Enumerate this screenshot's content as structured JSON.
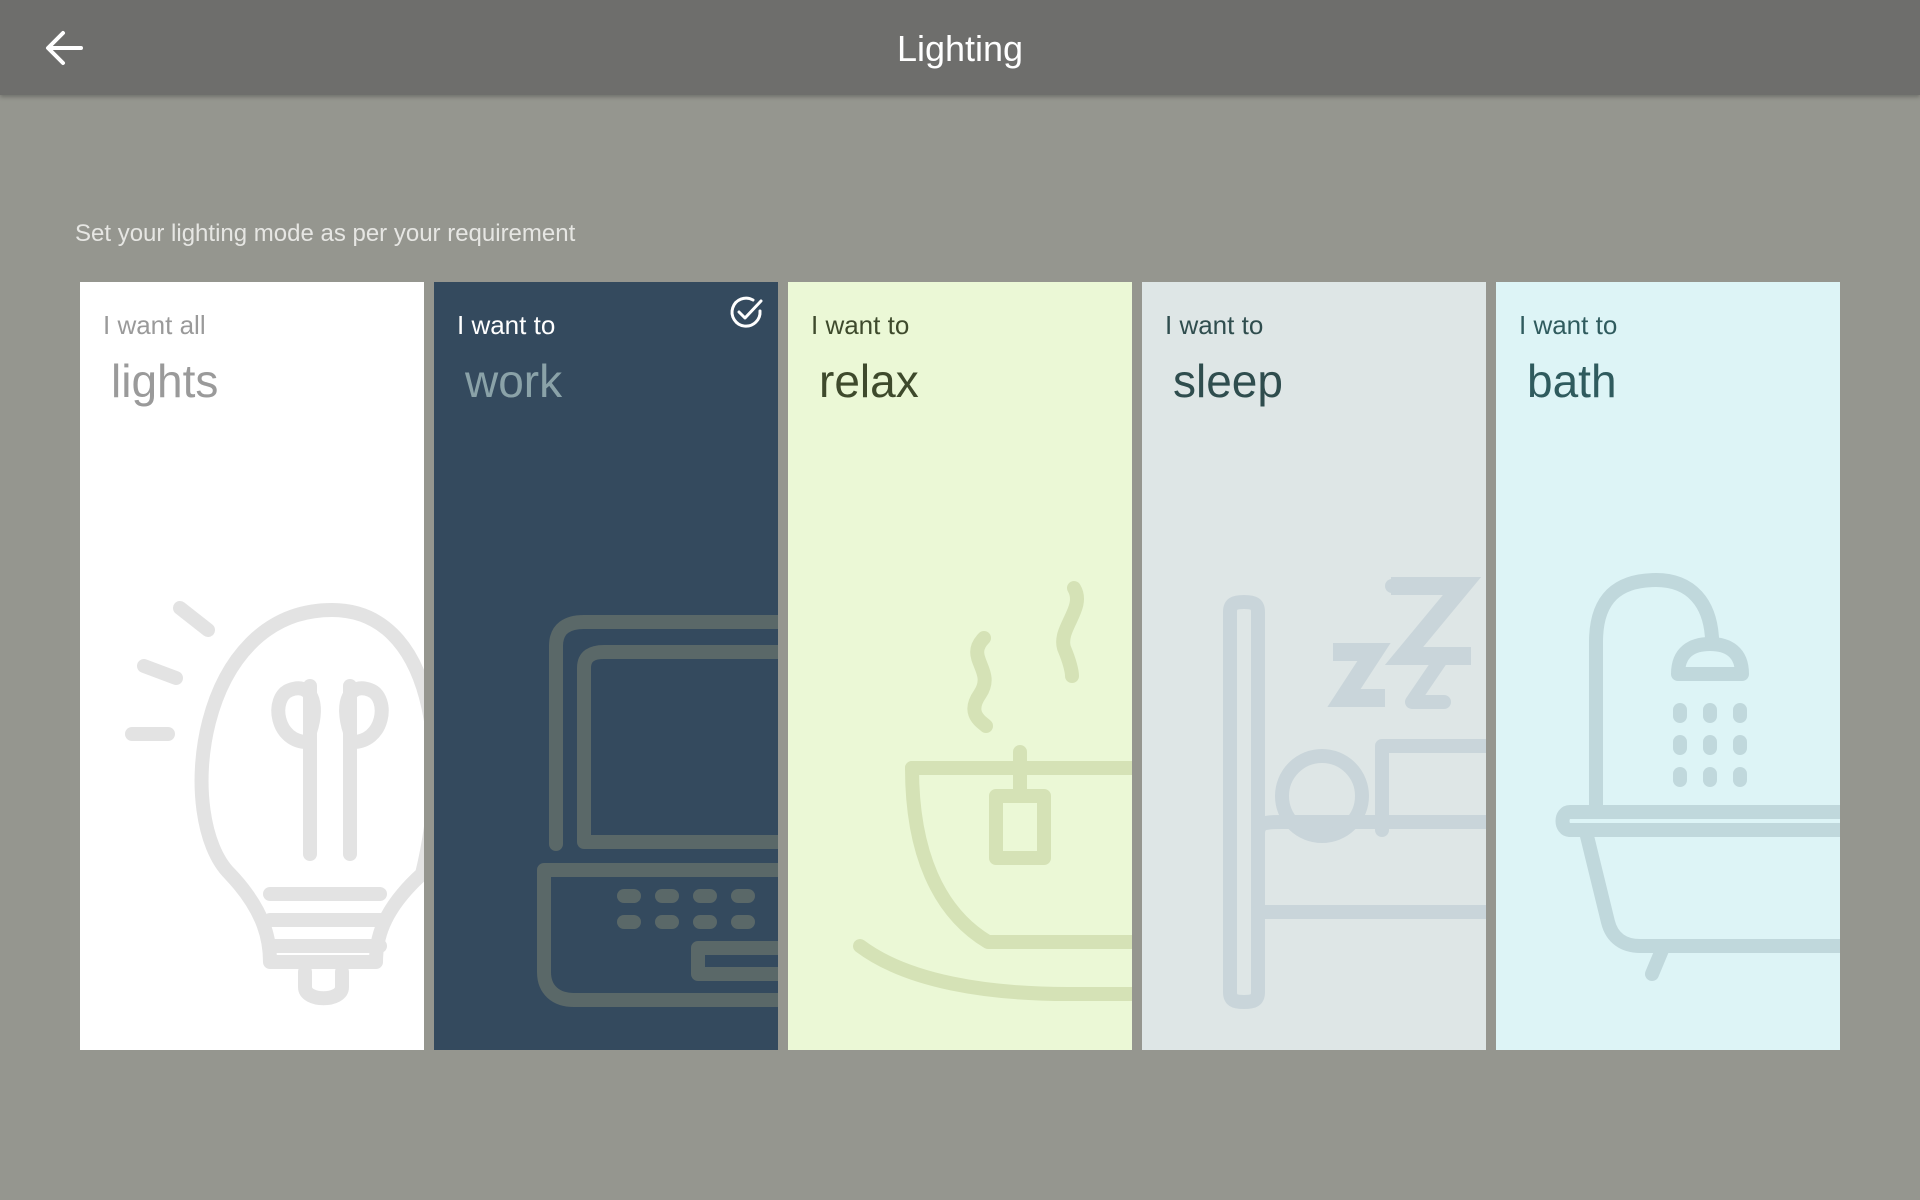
{
  "header": {
    "title": "Lighting",
    "back_icon": "arrow-left-icon"
  },
  "subtitle": "Set your lighting mode as per your requirement",
  "modes": [
    {
      "prefix": "I want all",
      "name": "lights",
      "icon": "lightbulb-icon",
      "background": "#ffffff",
      "selected": false
    },
    {
      "prefix": "I want to",
      "name": "work",
      "icon": "laptop-icon",
      "background": "#344a5e",
      "selected": true
    },
    {
      "prefix": "I want to",
      "name": "relax",
      "icon": "teacup-icon",
      "background": "#ebf8d6",
      "selected": false
    },
    {
      "prefix": "I want to",
      "name": "sleep",
      "icon": "bed-icon",
      "background": "#dee6e6",
      "selected": false
    },
    {
      "prefix": "I want to",
      "name": "bath",
      "icon": "bathtub-shower-icon",
      "background": "#ddf4f6",
      "selected": false
    }
  ],
  "selected_icon": "check-circle-icon"
}
